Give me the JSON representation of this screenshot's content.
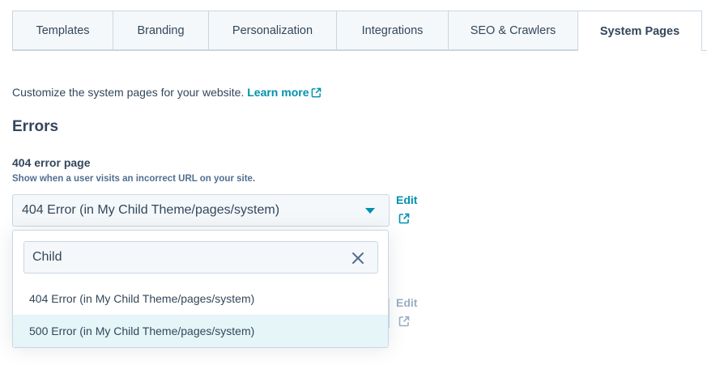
{
  "tabs": [
    {
      "label": "Templates"
    },
    {
      "label": "Branding"
    },
    {
      "label": "Personalization"
    },
    {
      "label": "Integrations"
    },
    {
      "label": "SEO & Crawlers"
    },
    {
      "label": "System Pages",
      "active": true
    }
  ],
  "intro": {
    "text": "Customize the system pages for your website.",
    "learn_more": "Learn more",
    "learn_more_icon": "external-link-icon"
  },
  "section": {
    "title": "Errors"
  },
  "field_404": {
    "label": "404 error page",
    "help": "Show when a user visits an incorrect URL on your site.",
    "selected": "404 Error (in My Child Theme/pages/system)",
    "edit_label": "Edit",
    "edit_icon": "external-link-icon"
  },
  "field_500": {
    "edit_label": "Edit",
    "edit_icon": "external-link-icon"
  },
  "dropdown": {
    "search_value": "Child",
    "clear_icon": "close-icon",
    "options": [
      {
        "label": "404 Error (in My Child Theme/pages/system)"
      },
      {
        "label": "500 Error (in My Child Theme/pages/system)",
        "highlighted": true
      }
    ]
  },
  "colors": {
    "accent": "#0091ae",
    "text": "#33475b",
    "border": "#cbd6e2",
    "highlight": "#e5f5f8"
  }
}
